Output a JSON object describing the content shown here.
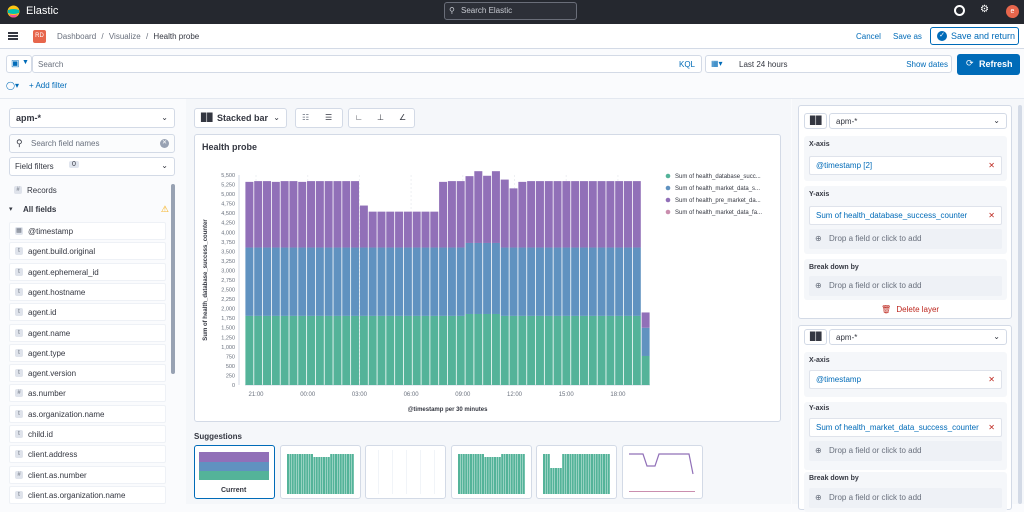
{
  "topbar": {
    "app_name": "Elastic",
    "search_placeholder": "Search Elastic",
    "avatar_letter": "e"
  },
  "breadcrumb": {
    "space_badge": "RD",
    "items": [
      "Dashboard",
      "Visualize",
      "Health probe"
    ],
    "separator": "/"
  },
  "header_actions": {
    "cancel": "Cancel",
    "save_as": "Save as",
    "save_and_return": "Save and return"
  },
  "query": {
    "search_placeholder": "Search",
    "language": "KQL",
    "time_range": "Last 24 hours",
    "show_dates": "Show dates",
    "refresh": "Refresh",
    "add_filter": "+ Add filter"
  },
  "sidebar": {
    "index_pattern": "apm-*",
    "field_search_placeholder": "Search field names",
    "field_filters_label": "Field filters",
    "field_filters_count": "0",
    "records_label": "Records",
    "all_fields_label": "All fields",
    "fields": [
      {
        "name": "@timestamp",
        "type": "date"
      },
      {
        "name": "agent.build.original",
        "type": "t"
      },
      {
        "name": "agent.ephemeral_id",
        "type": "t"
      },
      {
        "name": "agent.hostname",
        "type": "t"
      },
      {
        "name": "agent.id",
        "type": "t"
      },
      {
        "name": "agent.name",
        "type": "t"
      },
      {
        "name": "agent.type",
        "type": "t"
      },
      {
        "name": "agent.version",
        "type": "t"
      },
      {
        "name": "as.number",
        "type": "#"
      },
      {
        "name": "as.organization.name",
        "type": "t"
      },
      {
        "name": "child.id",
        "type": "t"
      },
      {
        "name": "client.address",
        "type": "t"
      },
      {
        "name": "client.as.number",
        "type": "#"
      },
      {
        "name": "client.as.organization.name",
        "type": "t"
      }
    ]
  },
  "toolbar": {
    "chart_type_label": "Stacked bar"
  },
  "chart_data": {
    "type": "bar",
    "title": "Health probe",
    "xlabel": "@timestamp per 30 minutes",
    "ylabel": "Sum of health_database_success_counter",
    "ylim": [
      0,
      5500
    ],
    "yticks": [
      "0",
      "250",
      "500",
      "750",
      "1,000",
      "1,250",
      "1,500",
      "1,750",
      "2,000",
      "2,250",
      "2,500",
      "2,750",
      "3,000",
      "3,250",
      "3,500",
      "3,750",
      "4,000",
      "4,250",
      "4,500",
      "4,750",
      "5,000",
      "5,250",
      "5,500"
    ],
    "xticks": [
      "21:00",
      "00:00",
      "03:00",
      "06:00",
      "09:00",
      "12:00",
      "15:00",
      "18:00"
    ],
    "grid": true,
    "legend_position": "right",
    "series": [
      {
        "name": "Sum of health_database_succ...",
        "color": "#54b399",
        "values": [
          1810,
          1810,
          1810,
          1810,
          1810,
          1810,
          1810,
          1810,
          1810,
          1810,
          1810,
          1810,
          1810,
          1810,
          1810,
          1810,
          1810,
          1810,
          1810,
          1810,
          1810,
          1810,
          1810,
          1810,
          1810,
          1860,
          1860,
          1860,
          1860,
          1810,
          1810,
          1810,
          1810,
          1810,
          1810,
          1810,
          1810,
          1810,
          1810,
          1810,
          1810,
          1810,
          1810,
          1810,
          1810,
          760
        ]
      },
      {
        "name": "Sum of health_market_data_s...",
        "color": "#6092c0",
        "values": [
          1790,
          1790,
          1790,
          1790,
          1790,
          1790,
          1790,
          1790,
          1790,
          1790,
          1790,
          1790,
          1790,
          1790,
          1790,
          1790,
          1790,
          1790,
          1790,
          1790,
          1790,
          1790,
          1790,
          1790,
          1790,
          1860,
          1860,
          1860,
          1860,
          1790,
          1790,
          1790,
          1790,
          1790,
          1790,
          1790,
          1790,
          1790,
          1790,
          1790,
          1790,
          1790,
          1790,
          1790,
          1790,
          740
        ]
      },
      {
        "name": "Sum of health_pre_market_da...",
        "color": "#9170b8",
        "values": [
          1720,
          1740,
          1740,
          1720,
          1740,
          1740,
          1720,
          1740,
          1740,
          1740,
          1740,
          1740,
          1740,
          1100,
          940,
          940,
          940,
          940,
          940,
          940,
          940,
          940,
          1720,
          1740,
          1740,
          1750,
          1880,
          1760,
          1880,
          1780,
          1550,
          1720,
          1740,
          1740,
          1740,
          1740,
          1740,
          1740,
          1740,
          1740,
          1740,
          1740,
          1740,
          1740,
          1740,
          400
        ]
      },
      {
        "name": "Sum of health_market_data_fa...",
        "color": "#ca8eae",
        "values": [
          0,
          0,
          0,
          0,
          0,
          0,
          0,
          0,
          0,
          0,
          0,
          0,
          0,
          0,
          0,
          0,
          0,
          0,
          0,
          0,
          0,
          0,
          0,
          0,
          0,
          0,
          0,
          0,
          0,
          0,
          0,
          0,
          0,
          0,
          0,
          0,
          0,
          0,
          0,
          0,
          0,
          0,
          0,
          0,
          0,
          0
        ]
      }
    ]
  },
  "suggestions": {
    "title": "Suggestions",
    "current_label": "Current"
  },
  "layers": [
    {
      "index_pattern": "apm-*",
      "x_axis_label": "X-axis",
      "x_axis_value": "@timestamp [2]",
      "y_axis_label": "Y-axis",
      "y_axis_value": "Sum of health_database_success_counter",
      "drop_label": "Drop a field or click to add",
      "breakdown_label": "Break down by",
      "delete_label": "Delete layer"
    },
    {
      "index_pattern": "apm-*",
      "x_axis_label": "X-axis",
      "x_axis_value": "@timestamp",
      "y_axis_label": "Y-axis",
      "y_axis_value": "Sum of health_market_data_success_counter",
      "drop_label": "Drop a field or click to add",
      "breakdown_label": "Break down by"
    }
  ]
}
